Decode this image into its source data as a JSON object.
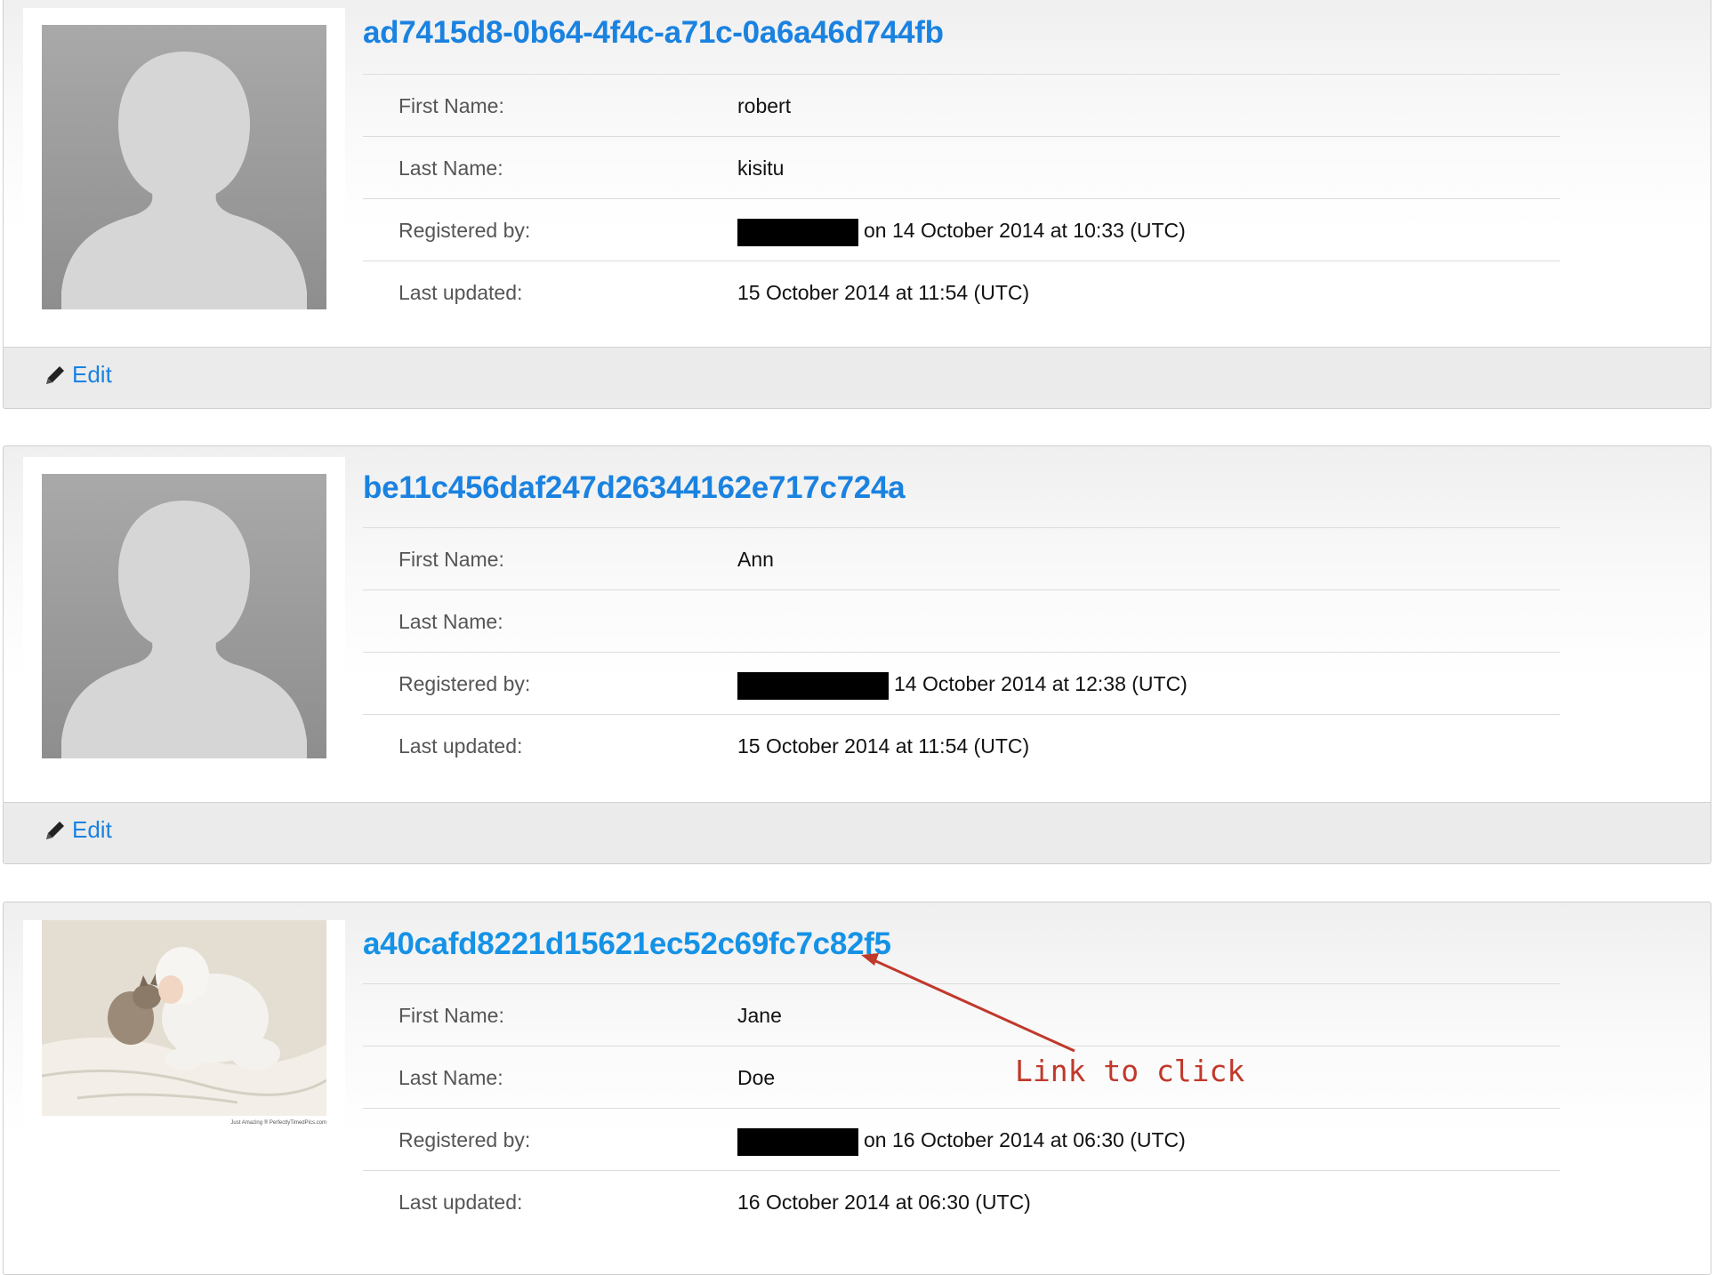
{
  "labels": {
    "first_name": "First Name:",
    "last_name": "Last Name:",
    "registered_by": "Registered by:",
    "last_updated": "Last updated:",
    "edit": "Edit"
  },
  "users": [
    {
      "id": "ad7415d8-0b64-4f4c-a71c-0a6a46d744fb",
      "first_name": "robert",
      "last_name": "kisitu",
      "registered_text": "on 14 October 2014 at 10:33 (UTC)",
      "last_updated": "15 October 2014 at 11:54 (UTC)",
      "photo": "default-avatar"
    },
    {
      "id": "be11c456daf247d26344162e717c724a",
      "first_name": "Ann",
      "last_name": "",
      "registered_text": "14 October 2014 at 12:38 (UTC)",
      "last_updated": "15 October 2014 at 11:54 (UTC)",
      "photo": "default-avatar"
    },
    {
      "id": "a40cafd8221d15621ec52c69fc7c82f5",
      "first_name": "Jane",
      "last_name": "Doe",
      "registered_text": "on 16 October 2014 at 06:30 (UTC)",
      "last_updated": "16 October 2014 at 06:30 (UTC)",
      "photo": "baby-and-kitten-photo",
      "photo_caption": "Just Amazing ® PerfectlyTimedPics.com"
    }
  ],
  "annotation": {
    "text": "Link to click",
    "color": "#c0392b"
  },
  "colors": {
    "link": "#1a82e0",
    "redaction": "#000000"
  },
  "icons": {
    "edit": "pencil-icon"
  }
}
